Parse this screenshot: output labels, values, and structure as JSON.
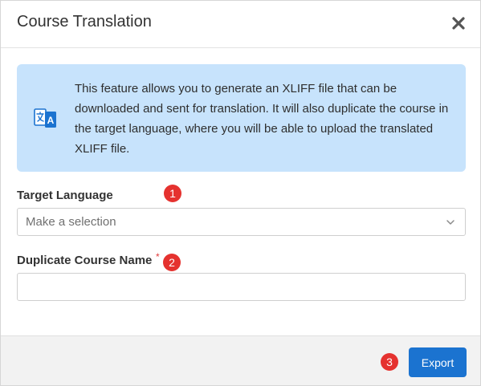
{
  "dialog": {
    "title": "Course Translation",
    "close_icon": "close-icon"
  },
  "info": {
    "icon": "translate-icon",
    "text": "This feature allows you to generate an XLIFF file that can be downloaded and sent for translation. It will also duplicate the course in the target language, where you will be able to upload the translated XLIFF file."
  },
  "form": {
    "target_language": {
      "label": "Target Language",
      "selected": "Make a selection"
    },
    "duplicate_name": {
      "label": "Duplicate Course Name",
      "required_mark": "*",
      "value": ""
    }
  },
  "markers": [
    "1",
    "2",
    "3"
  ],
  "footer": {
    "export_label": "Export"
  },
  "colors": {
    "info_bg": "#c7e3fc",
    "primary": "#1b73d0",
    "marker": "#e5322f",
    "required": "#e03b3b"
  }
}
